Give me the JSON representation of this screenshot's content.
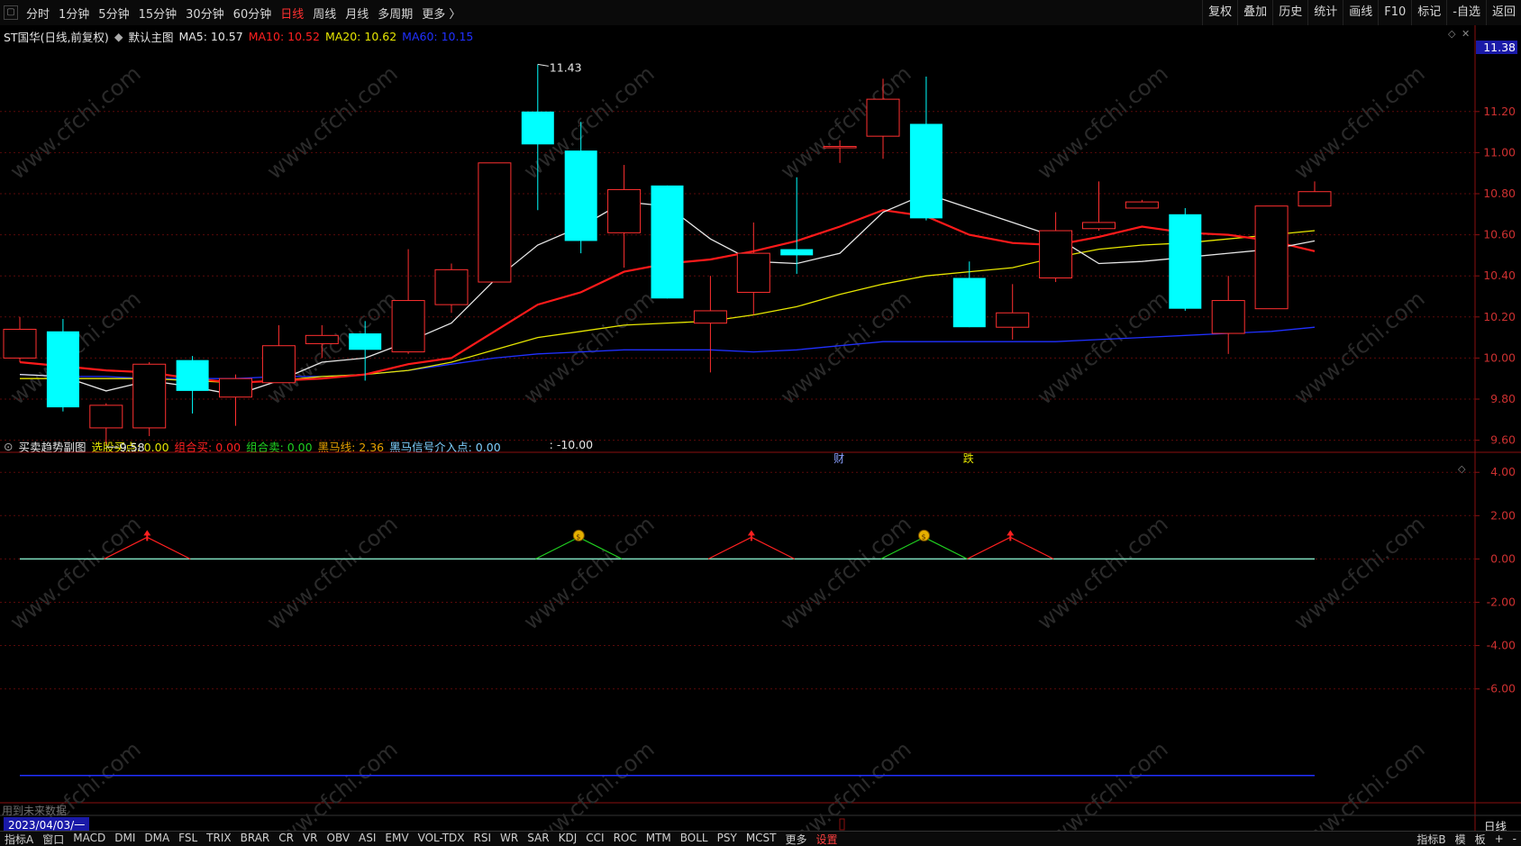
{
  "toolbar": {
    "timeframes": [
      "分时",
      "1分钟",
      "5分钟",
      "15分钟",
      "30分钟",
      "60分钟",
      "日线",
      "周线",
      "月线",
      "多周期",
      "更多 〉"
    ],
    "active": "日线",
    "right_buttons": [
      "复权",
      "叠加",
      "历史",
      "统计",
      "画线",
      "F10",
      "标记",
      "-自选",
      "返回"
    ]
  },
  "main": {
    "stock_title": "ST国华(日线,前复权)",
    "chart_name": "默认主图",
    "ma": [
      {
        "label": "MA5: 10.57",
        "color": "#e6e6e6"
      },
      {
        "label": "MA10: 10.52",
        "color": "#ff2020"
      },
      {
        "label": "MA20: 10.62",
        "color": "#e6e600"
      },
      {
        "label": "MA60: 10.15",
        "color": "#2030ff"
      }
    ],
    "price_axis": [
      "11.20",
      "11.00",
      "10.80",
      "10.60",
      "10.40",
      "10.20",
      "10.00",
      "9.80",
      "9.60"
    ],
    "current_price": "11.38",
    "high_label": "11.43",
    "low_label": "9.58",
    "markers": [
      {
        "text": "财",
        "color": "#8aa0ff"
      },
      {
        "text": "跌",
        "color": "#e6e600"
      }
    ]
  },
  "sub": {
    "name": "买卖趋势副图",
    "indicators": [
      {
        "label": "选股买点: 0.00",
        "color": "#e6e600"
      },
      {
        "label": "组合买: 0.00",
        "color": "#ff2020"
      },
      {
        "label": "组合卖: 0.00",
        "color": "#20d020"
      },
      {
        "label": "黑马线: 2.36",
        "color": "#e6a000"
      },
      {
        "label": "黑马信号介入点: 0.00",
        "color": "#7fd0ff"
      },
      {
        "label": ": -10.00",
        "color": "#e6e6e6"
      }
    ],
    "axis": [
      "4.00",
      "2.00",
      "0.00",
      "-2.00",
      "-4.00",
      "-6.00"
    ],
    "note": "用到未来数据"
  },
  "status": {
    "date": "2023/04/03/一",
    "period": "日线"
  },
  "bottom": {
    "tabs": [
      "指标A",
      "窗口",
      "MACD",
      "DMI",
      "DMA",
      "FSL",
      "TRIX",
      "BRAR",
      "CR",
      "VR",
      "OBV",
      "ASI",
      "EMV",
      "VOL-TDX",
      "RSI",
      "WR",
      "SAR",
      "KDJ",
      "CCI",
      "ROC",
      "MTM",
      "BOLL",
      "PSY",
      "MCST",
      "更多",
      "设置"
    ],
    "right": [
      "指标B",
      "模",
      "板",
      "+",
      "-"
    ]
  },
  "watermark": "www.cfchi.com",
  "chart_data": {
    "type": "candlestick",
    "ylim": [
      9.55,
      11.55
    ],
    "candles": [
      {
        "o": 10.0,
        "c": 10.14,
        "h": 10.2,
        "l": 9.98
      },
      {
        "o": 10.13,
        "c": 9.76,
        "h": 10.19,
        "l": 9.74
      },
      {
        "o": 9.66,
        "c": 9.77,
        "h": 9.78,
        "l": 9.58
      },
      {
        "o": 9.66,
        "c": 9.97,
        "h": 9.98,
        "l": 9.62
      },
      {
        "o": 9.99,
        "c": 9.84,
        "h": 10.01,
        "l": 9.73
      },
      {
        "o": 9.81,
        "c": 9.9,
        "h": 9.92,
        "l": 9.67
      },
      {
        "o": 9.88,
        "c": 10.06,
        "h": 10.16,
        "l": 9.88
      },
      {
        "o": 10.07,
        "c": 10.11,
        "h": 10.16,
        "l": 10.0
      },
      {
        "o": 10.12,
        "c": 10.04,
        "h": 10.18,
        "l": 9.89
      },
      {
        "o": 10.03,
        "c": 10.28,
        "h": 10.53,
        "l": 10.02
      },
      {
        "o": 10.26,
        "c": 10.43,
        "h": 10.46,
        "l": 10.22
      },
      {
        "o": 10.37,
        "c": 10.95,
        "h": 10.95,
        "l": 10.37
      },
      {
        "o": 11.2,
        "c": 11.04,
        "h": 11.43,
        "l": 10.72
      },
      {
        "o": 11.01,
        "c": 10.57,
        "h": 11.15,
        "l": 10.51
      },
      {
        "o": 10.61,
        "c": 10.82,
        "h": 10.94,
        "l": 10.44
      },
      {
        "o": 10.84,
        "c": 10.29,
        "h": 10.84,
        "l": 10.29
      },
      {
        "o": 10.17,
        "c": 10.23,
        "h": 10.4,
        "l": 9.93
      },
      {
        "o": 10.32,
        "c": 10.51,
        "h": 10.66,
        "l": 10.21
      },
      {
        "o": 10.53,
        "c": 10.5,
        "h": 10.88,
        "l": 10.41
      },
      {
        "o": 11.03,
        "c": 11.03,
        "h": 11.06,
        "l": 10.95
      },
      {
        "o": 11.08,
        "c": 11.26,
        "h": 11.36,
        "l": 10.97
      },
      {
        "o": 11.14,
        "c": 10.68,
        "h": 11.37,
        "l": 10.67
      },
      {
        "o": 10.39,
        "c": 10.15,
        "h": 10.47,
        "l": 10.15
      },
      {
        "o": 10.15,
        "c": 10.22,
        "h": 10.36,
        "l": 10.09
      },
      {
        "o": 10.39,
        "c": 10.62,
        "h": 10.71,
        "l": 10.37
      },
      {
        "o": 10.63,
        "c": 10.66,
        "h": 10.86,
        "l": 10.62
      },
      {
        "o": 10.73,
        "c": 10.76,
        "h": 10.77,
        "l": 10.73
      },
      {
        "o": 10.7,
        "c": 10.24,
        "h": 10.73,
        "l": 10.23
      },
      {
        "o": 10.12,
        "c": 10.28,
        "h": 10.4,
        "l": 10.02
      },
      {
        "o": 10.24,
        "c": 10.74,
        "h": 10.74,
        "l": 10.24
      },
      {
        "o": 10.74,
        "c": 10.81,
        "h": 10.86,
        "l": 10.74
      }
    ],
    "ma5": [
      9.92,
      9.91,
      9.84,
      9.89,
      9.86,
      9.82,
      9.89,
      9.98,
      10.0,
      10.08,
      10.17,
      10.38,
      10.55,
      10.64,
      10.76,
      10.74,
      10.58,
      10.47,
      10.46,
      10.51,
      10.71,
      10.8,
      10.73,
      10.66,
      10.59,
      10.46,
      10.47,
      10.49,
      10.51,
      10.53,
      10.57
    ],
    "ma10": [
      9.98,
      9.96,
      9.94,
      9.93,
      9.9,
      9.88,
      9.89,
      9.9,
      9.92,
      9.97,
      10.0,
      10.13,
      10.26,
      10.32,
      10.42,
      10.46,
      10.48,
      10.52,
      10.57,
      10.64,
      10.72,
      10.69,
      10.6,
      10.56,
      10.55,
      10.59,
      10.64,
      10.61,
      10.6,
      10.57,
      10.52
    ],
    "ma20": [
      9.9,
      9.9,
      9.9,
      9.9,
      9.89,
      9.88,
      9.89,
      9.91,
      9.92,
      9.94,
      9.98,
      10.04,
      10.1,
      10.13,
      10.16,
      10.17,
      10.18,
      10.21,
      10.25,
      10.31,
      10.36,
      10.4,
      10.42,
      10.44,
      10.49,
      10.53,
      10.55,
      10.56,
      10.58,
      10.6,
      10.62
    ],
    "ma60": [
      9.92,
      9.91,
      9.91,
      9.9,
      9.9,
      9.9,
      9.91,
      9.91,
      9.92,
      9.94,
      9.97,
      10.0,
      10.02,
      10.03,
      10.04,
      10.04,
      10.04,
      10.03,
      10.04,
      10.06,
      10.08,
      10.08,
      10.08,
      10.08,
      10.08,
      10.09,
      10.1,
      10.11,
      10.12,
      10.13,
      10.15
    ],
    "sub": {
      "ylim": [
        -10.8,
        4.8
      ],
      "zero_line": 0,
      "bottom_line": -10,
      "buy_signals": [
        {
          "i": 1.5,
          "color": "#ff2020",
          "icon": "arrow"
        },
        {
          "i": 8.5,
          "color": "#20d020",
          "icon": "money"
        },
        {
          "i": 11.5,
          "color": "#ff2020",
          "icon": "arrow"
        },
        {
          "i": 15.5,
          "color": "#20d020",
          "icon": "money"
        },
        {
          "i": 17.5,
          "color": "#ff2020",
          "icon": "arrow"
        }
      ],
      "peak": 1.0
    }
  }
}
